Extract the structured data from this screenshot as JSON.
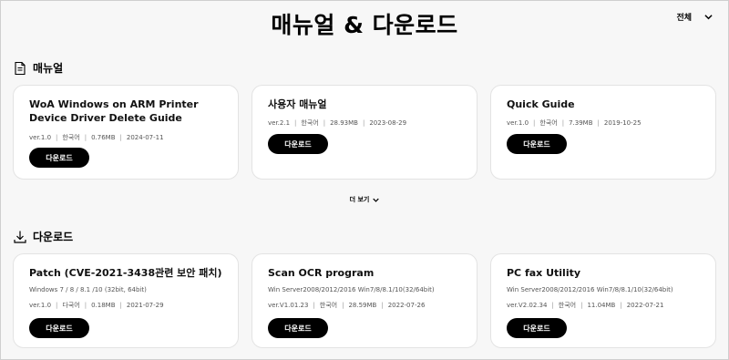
{
  "page": {
    "title": "매뉴얼 & 다운로드"
  },
  "filter": {
    "selected": "전체"
  },
  "manuals": {
    "heading": "매뉴얼",
    "more_label": "더 보기",
    "cards": [
      {
        "title": "WoA Windows on ARM Printer Device Driver Delete Guide",
        "version": "ver.1.0",
        "language": "한국어",
        "size": "0.76MB",
        "date": "2024-07-11",
        "button": "다운로드"
      },
      {
        "title": "사용자 매뉴얼",
        "version": "ver.2.1",
        "language": "한국어",
        "size": "28.93MB",
        "date": "2023-08-29",
        "button": "다운로드"
      },
      {
        "title": "Quick Guide",
        "version": "ver.1.0",
        "language": "한국어",
        "size": "7.39MB",
        "date": "2019-10-25",
        "button": "다운로드"
      }
    ]
  },
  "downloads": {
    "heading": "다운로드",
    "cards": [
      {
        "title": "Patch (CVE-2021-3438관련 보안 패치)",
        "os": "Windows 7 / 8 / 8.1 /10 (32bit, 64bit)",
        "version": "ver.1.0",
        "language": "다국어",
        "size": "0.18MB",
        "date": "2021-07-29",
        "button": "다운로드"
      },
      {
        "title": "Scan OCR program",
        "os": "Win Server2008/2012/2016 Win7/8/8.1/10(32/64bit)",
        "version": "ver.V1.01.23",
        "language": "한국어",
        "size": "28.59MB",
        "date": "2022-07-26",
        "button": "다운로드"
      },
      {
        "title": "PC fax Utility",
        "os": "Win Server2008/2012/2016 Win7/8/8.1/10(32/64bit)",
        "version": "ver.V2.02.34",
        "language": "한국어",
        "size": "11.04MB",
        "date": "2022-07-21",
        "button": "다운로드"
      }
    ]
  }
}
